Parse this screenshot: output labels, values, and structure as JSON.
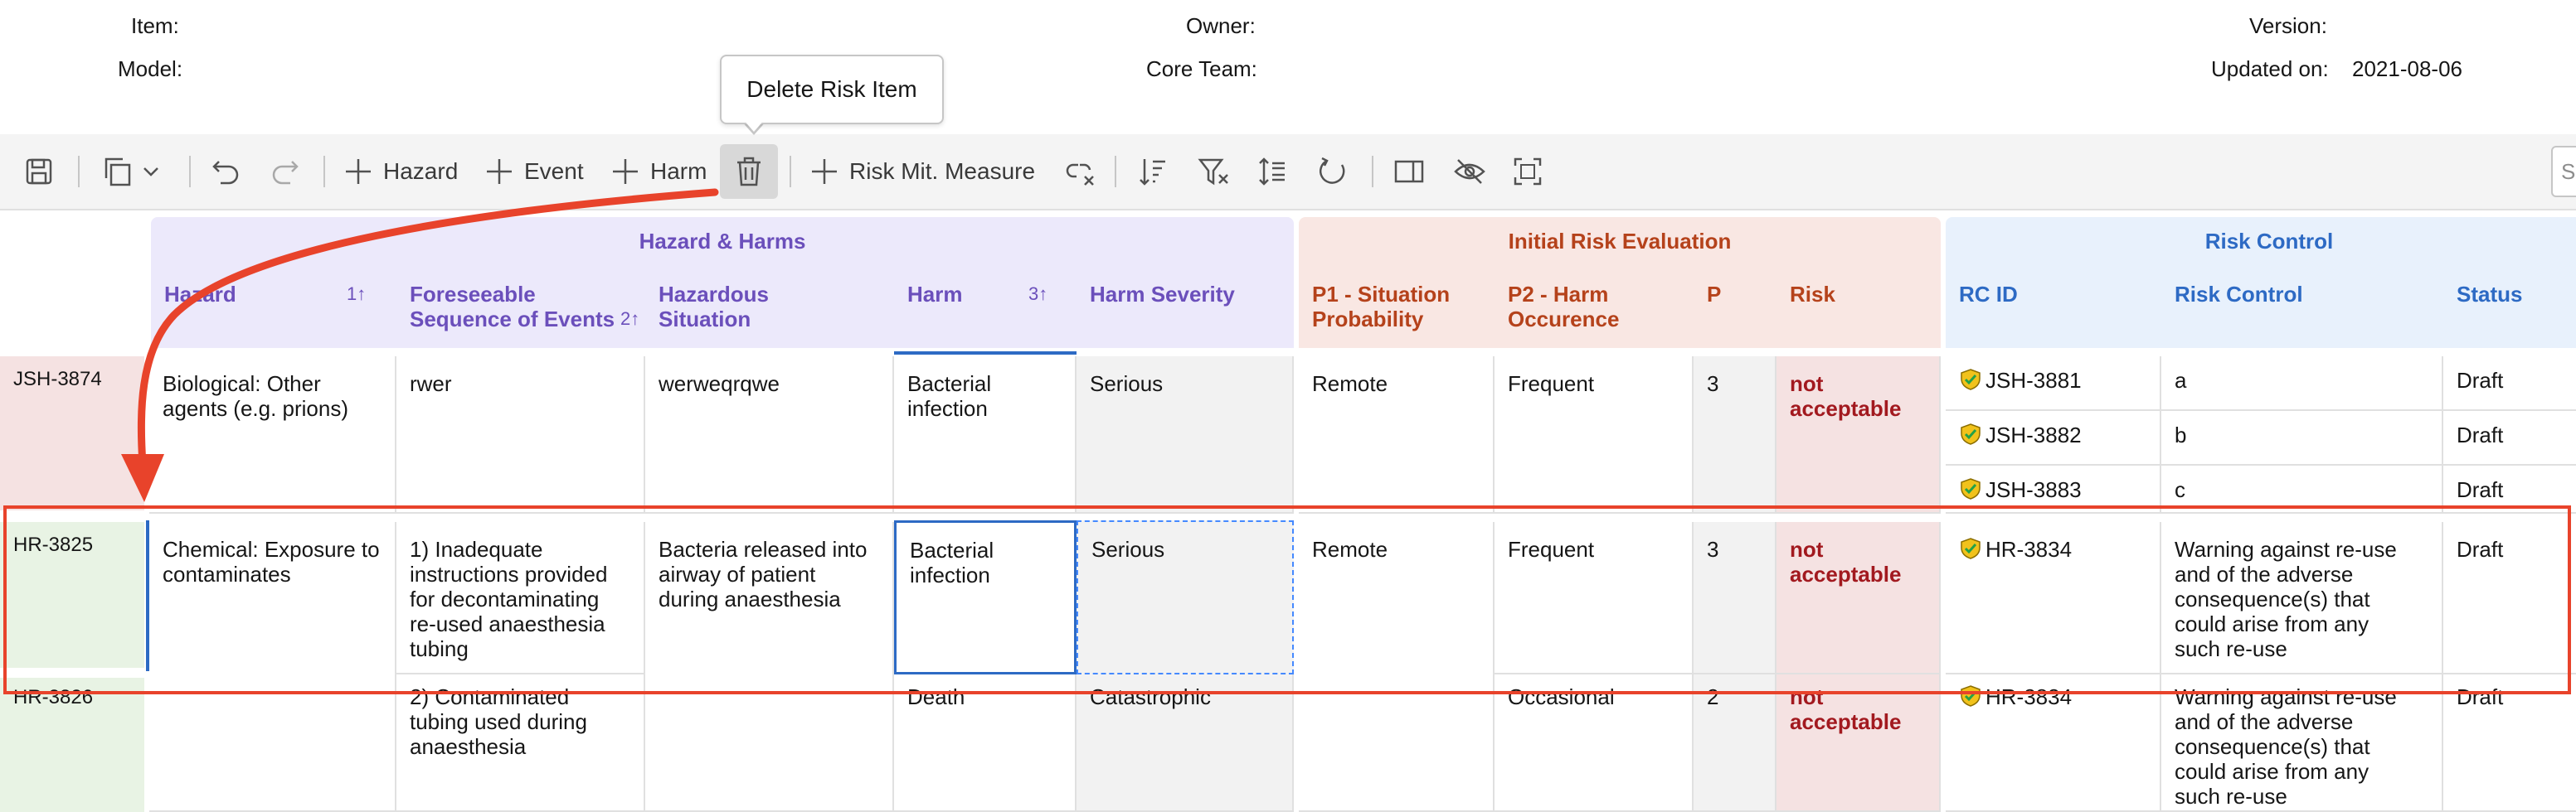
{
  "meta": {
    "item_label": "Item:",
    "owner_label": "Owner:",
    "version_label": "Version:",
    "model_label": "Model:",
    "core_team_label": "Core Team:",
    "updated_label": "Updated on:",
    "updated_value": "2021-08-06"
  },
  "tooltip": {
    "text": "Delete Risk Item"
  },
  "toolbar": {
    "hazard": "Hazard",
    "event": "Event",
    "harm": "Harm",
    "risk_mit": "Risk Mit. Measure",
    "search_placeholder": "Se"
  },
  "groups": {
    "hazard_harms": "Hazard & Harms",
    "initial_risk": "Initial Risk Evaluation",
    "risk_control": "Risk Control"
  },
  "columns": {
    "hazard": "Hazard",
    "hazard_sort": "1↑",
    "events_1": "Foreseeable",
    "events_2": "Sequence of Events",
    "events_sort": "2↑",
    "situation_1": "Hazardous",
    "situation_2": "Situation",
    "harm": "Harm",
    "harm_sort": "3↑",
    "severity": "Harm Severity",
    "p1_1": "P1 - Situation",
    "p1_2": "Probability",
    "p2_1": "P2 - Harm",
    "p2_2": "Occurence",
    "p": "P",
    "risk": "Risk",
    "rc_id": "RC ID",
    "risk_control": "Risk Control",
    "status": "Status"
  },
  "rows": [
    {
      "id": "JSH-3874",
      "hazard": "Biological: Other agents (e.g. prions)",
      "event": "rwer",
      "situation": "werweqrqwe",
      "harm": "Bacterial infection",
      "severity": "Serious",
      "p1": "Remote",
      "p2": "Frequent",
      "p": "3",
      "risk": "not acceptable",
      "controls": [
        {
          "rc_id": "JSH-3881",
          "text": "a",
          "status": "Draft"
        },
        {
          "rc_id": "JSH-3882",
          "text": "b",
          "status": "Draft"
        },
        {
          "rc_id": "JSH-3883",
          "text": "c",
          "status": "Draft"
        }
      ]
    },
    {
      "id": "HR-3825",
      "hazard": "Chemical: Exposure to contaminates",
      "event": "1) Inadequate instructions provided for decontaminating re-used anaesthesia tubing",
      "situation": "Bacteria released into airway of patient during anaesthesia",
      "harm": "Bacterial infection",
      "severity": "Serious",
      "p1": "Remote",
      "p2": "Frequent",
      "p": "3",
      "risk": "not acceptable",
      "controls": [
        {
          "rc_id": "HR-3834",
          "text": "Warning against re-use and of the adverse consequence(s) that could arise from any such re-use",
          "status": "Draft"
        }
      ]
    },
    {
      "id": "HR-3826",
      "hazard": "",
      "event": "2) Contaminated tubing used during anaesthesia",
      "situation": "",
      "harm": "Death",
      "severity": "Catastrophic",
      "p1": "",
      "p2": "Occasional",
      "p": "2",
      "risk": "not acceptable",
      "controls": [
        {
          "rc_id": "HR-3834",
          "text": "Warning against re-use and of the adverse consequence(s) that could arise from any such re-use",
          "status": "Draft"
        }
      ]
    }
  ],
  "colors": {
    "hazard_group_bg": "#ece9fb",
    "hazard_group_text": "#6b4fbb",
    "initial_group_bg": "#f9e7e3",
    "initial_group_text": "#b5421b",
    "rc_group_bg": "#e8f1fc",
    "rc_group_text": "#2d6ac4",
    "risk_cell_bg": "#f5e2e2",
    "severity_cell_bg": "#f2f2f2",
    "annotation_red": "#e8432b",
    "selection_blue": "#2d6ac4"
  }
}
